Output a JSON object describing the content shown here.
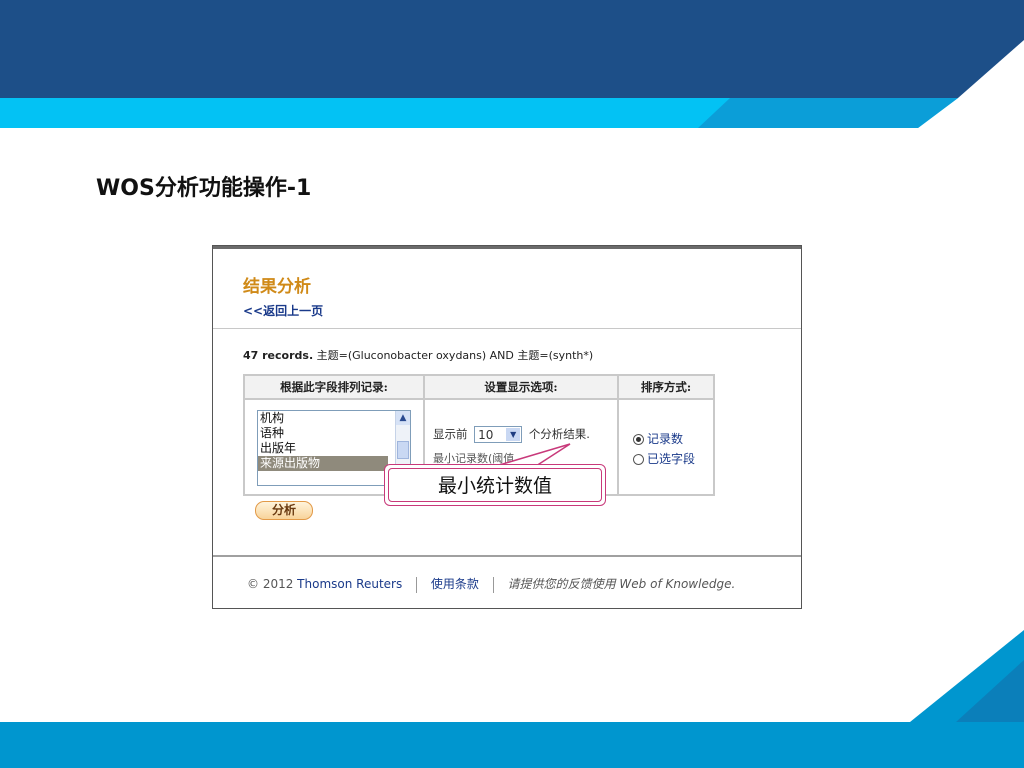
{
  "slide": {
    "title": "WOS分析功能操作-1",
    "colors": {
      "dark_band": "#1d4f88",
      "light_band": "#03c2f4",
      "bottom_band": "#0096cf"
    }
  },
  "panel": {
    "heading": "结果分析",
    "back_link": "<<返回上一页",
    "query_count": "47 records.",
    "query_text": " 主题=(Gluconobacter oxydans) AND 主题=(synth*)",
    "columns": [
      "根据此字段排列记录:",
      "设置显示选项:",
      "排序方式:"
    ],
    "field_list": {
      "items": [
        "机构",
        "语种",
        "出版年",
        "来源出版物"
      ],
      "selected_index": 3
    },
    "display_options": {
      "prefix": "显示前",
      "count_value": "10",
      "suffix": "个分析结果.",
      "min_count_partial": "最小记录数(阈值"
    },
    "sort_options": [
      {
        "label": "记录数",
        "checked": true
      },
      {
        "label": "已选字段",
        "checked": false
      }
    ],
    "analyze_button": "分析",
    "footer": {
      "copyright": "© 2012 ",
      "company": "Thomson Reuters",
      "terms": "使用条款",
      "feedback_pre": "请提供您的",
      "feedback_link": "反馈",
      "feedback_post": "使用",
      "product": "Web of Knowledge."
    }
  },
  "callout": {
    "text": "最小统计数值"
  }
}
